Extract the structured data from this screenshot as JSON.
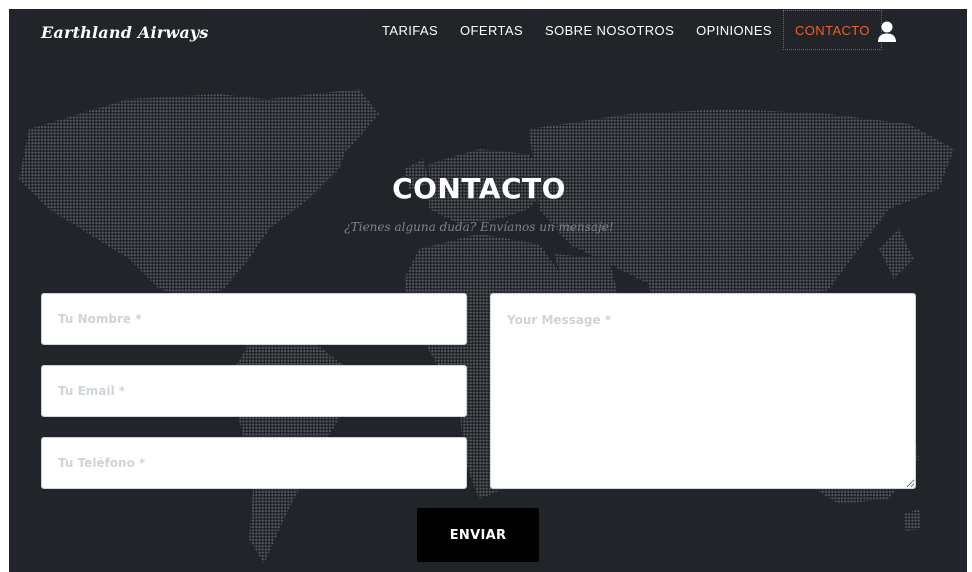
{
  "brand": "Earthland Airways",
  "nav": {
    "items": [
      {
        "label": "TARIFAS",
        "name": "nav-link-tarifas",
        "active": false
      },
      {
        "label": "OFERTAS",
        "name": "nav-link-ofertas",
        "active": false
      },
      {
        "label": "SOBRE NOSOTROS",
        "name": "nav-link-sobre-nosotros",
        "active": false
      },
      {
        "label": "OPINIONES",
        "name": "nav-link-opiniones",
        "active": false
      },
      {
        "label": "CONTACTO",
        "name": "nav-link-contacto",
        "active": true
      }
    ],
    "user_icon": "user-icon"
  },
  "hero": {
    "title": "CONTACTO",
    "subtitle": "¿Tienes alguna duda? Envíanos un mensaje!"
  },
  "form": {
    "name_placeholder": "Tu Nombre *",
    "email_placeholder": "Tu Email *",
    "phone_placeholder": "Tu Teléfono *",
    "message_placeholder": "Your Message *",
    "submit_label": "ENVIAR"
  },
  "colors": {
    "background": "#212529",
    "accent": "#f05f2b",
    "map_dots": "#5a5e63",
    "button": "#000000"
  }
}
